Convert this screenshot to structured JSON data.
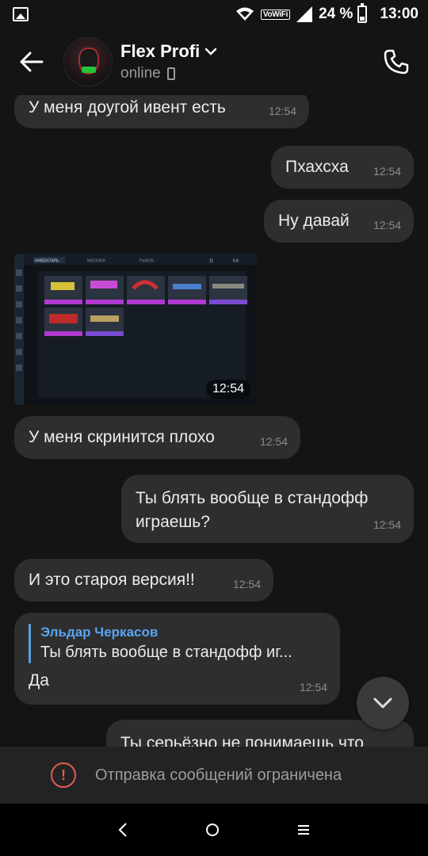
{
  "status_bar": {
    "vowifi": "VoWiFi",
    "battery": "24 %",
    "time": "13:00"
  },
  "header": {
    "contact_name": "Flex Profi",
    "contact_status": "online"
  },
  "messages": [
    {
      "side": "in",
      "text": "У меня доугой ивент есть",
      "time": "12:54"
    },
    {
      "side": "out",
      "text": "Пхахсха",
      "time": "12:54"
    },
    {
      "side": "out",
      "text": "Ну давай",
      "time": "12:54"
    },
    {
      "side": "in",
      "type": "photo",
      "time": "12:54"
    },
    {
      "side": "in",
      "text": "У меня скринится плохо",
      "time": "12:54"
    },
    {
      "side": "out",
      "text": "Ты блять вообще в стандофф играешь?",
      "time": "12:54"
    },
    {
      "side": "in",
      "text": "И это староя версия!!",
      "time": "12:54"
    },
    {
      "side": "in",
      "reply_name": "Эльдар Черкасов",
      "reply_quote": "Ты блять вообще в стандофф иг...",
      "text": "Да",
      "time": "12:54"
    },
    {
      "side": "out",
      "text": "Ты серьёзно не понимаешь что"
    }
  ],
  "photo": {
    "tabs": [
      "ИНВЕНТАРЬ",
      "МАГАЗИН",
      "РЫНОК"
    ],
    "counters": [
      "11",
      "5.6"
    ]
  },
  "footer": {
    "restricted_text": "Отправка сообщений ограничена"
  },
  "colors": {
    "background": "#141414",
    "bubble": "#2e2e2e",
    "accent_blue": "#5aa5ef",
    "warning_red": "#e25c55"
  },
  "icons": [
    "gallery-icon",
    "vowifi-icon",
    "signal-icon",
    "battery-icon",
    "back-arrow-icon",
    "chevron-down-icon",
    "phone-icon",
    "call-icon",
    "warning-icon",
    "nav-back-icon",
    "nav-home-icon",
    "nav-menu-icon"
  ]
}
